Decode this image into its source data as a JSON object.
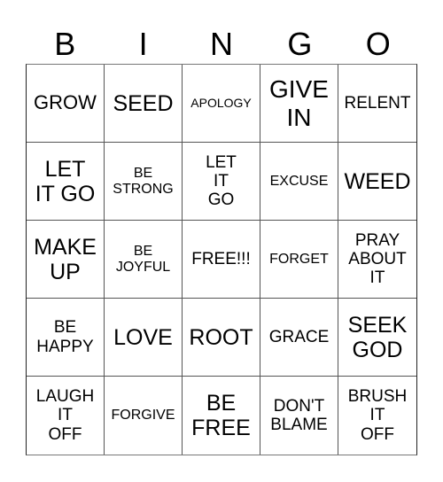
{
  "header": [
    "B",
    "I",
    "N",
    "G",
    "O"
  ],
  "cells": [
    {
      "text": "GROW",
      "size": "s-m"
    },
    {
      "text": "SEED",
      "size": "s-l"
    },
    {
      "text": "APOLOGY",
      "size": "s-xs"
    },
    {
      "text": "GIVE\nIN",
      "size": "s-xl"
    },
    {
      "text": "RELENT",
      "size": "s-sm"
    },
    {
      "text": "LET\nIT GO",
      "size": "s-l"
    },
    {
      "text": "BE\nSTRONG",
      "size": "s-s"
    },
    {
      "text": "LET\nIT\nGO",
      "size": "s-sm"
    },
    {
      "text": "EXCUSE",
      "size": "s-s"
    },
    {
      "text": "WEED",
      "size": "s-l"
    },
    {
      "text": "MAKE\nUP",
      "size": "s-l"
    },
    {
      "text": "BE\nJOYFUL",
      "size": "s-s"
    },
    {
      "text": "FREE!!!",
      "size": "s-sm"
    },
    {
      "text": "FORGET",
      "size": "s-s"
    },
    {
      "text": "PRAY\nABOUT\nIT",
      "size": "s-sm"
    },
    {
      "text": "BE\nHAPPY",
      "size": "s-sm"
    },
    {
      "text": "LOVE",
      "size": "s-l"
    },
    {
      "text": "ROOT",
      "size": "s-l"
    },
    {
      "text": "GRACE",
      "size": "s-sm"
    },
    {
      "text": "SEEK\nGOD",
      "size": "s-l"
    },
    {
      "text": "LAUGH\nIT\nOFF",
      "size": "s-sm"
    },
    {
      "text": "FORGIVE",
      "size": "s-s"
    },
    {
      "text": "BE\nFREE",
      "size": "s-l"
    },
    {
      "text": "DON'T\nBLAME",
      "size": "s-sm"
    },
    {
      "text": "BRUSH\nIT\nOFF",
      "size": "s-sm"
    }
  ]
}
